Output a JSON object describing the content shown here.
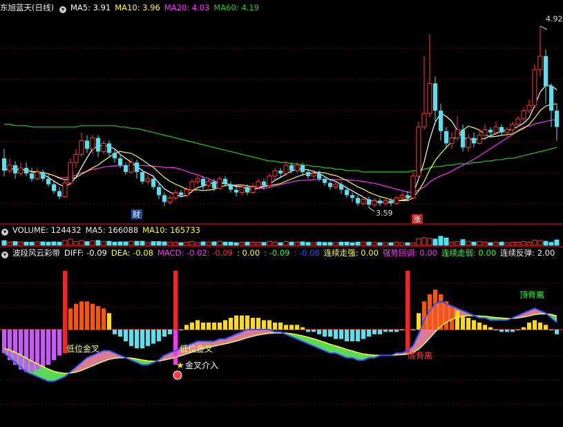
{
  "colors": {
    "background": "#000000",
    "rise": "#ff3b3b",
    "fall": "#54e1f0",
    "ma5": "#ffffff",
    "ma10": "#ffff33",
    "ma20": "#ff33ff",
    "ma60": "#22cc22",
    "grid": "#7a0000"
  },
  "price_panel": {
    "title": "东旭蓝天(日线)",
    "toggle_icon": "chevron-down-icon",
    "ma5_label": "MA5: 3.91",
    "ma10_label": "MA10: 3.96",
    "ma20_label": "MA20: 4.03",
    "ma60_label": "MA60: 4.19",
    "high_marker": "4.92",
    "low_marker": "3.59",
    "badge_finance": "财",
    "badge_rise": "涨"
  },
  "volume_panel": {
    "toggle_icon": "chevron-down-icon",
    "volume_label": "VOLUME: 124432",
    "ma5_label": "MA5: 166088",
    "ma10_label": "MA10: 165733"
  },
  "indicator_panel": {
    "toggle_icon": "chevron-down-icon",
    "title": "波段风云彩带",
    "diff_label": "DIFF: -0.09",
    "dea_label": "DEA: -0.08",
    "macd_label": "MACD: -0.02",
    "v1": ": -0.09",
    "v2": ": 0.00",
    "v3": ": -0.09",
    "v4": ": -0.08",
    "lianxu_zouqiang": "连续走强: 0.00",
    "qiangshi_huitiao": "强势回调: 0.00",
    "lianxu_zouruo": "连续走弱: 0.00",
    "lianxu_fantan": "连续反弹: 2.00",
    "ann_low_golden_1": "低位金叉",
    "ann_low_golden_2": "低位金叉",
    "ann_golden_entry": "金叉介入",
    "ann_bottom_div": "底背离",
    "ann_top_div": "顶背离"
  },
  "chart_data": {
    "type": "candlestick",
    "candles": [
      [
        3.95,
        3.86,
        4.02,
        3.82
      ],
      [
        3.86,
        3.9,
        3.95,
        3.84
      ],
      [
        3.9,
        3.84,
        3.93,
        3.8
      ],
      [
        3.84,
        3.88,
        3.92,
        3.82
      ],
      [
        3.88,
        3.84,
        3.92,
        3.82
      ],
      [
        3.84,
        3.8,
        3.88,
        3.78
      ],
      [
        3.8,
        3.85,
        3.88,
        3.79
      ],
      [
        3.85,
        3.8,
        3.87,
        3.78
      ],
      [
        3.8,
        3.76,
        3.83,
        3.74
      ],
      [
        3.76,
        3.71,
        3.78,
        3.69
      ],
      [
        3.71,
        3.67,
        3.74,
        3.65
      ],
      [
        3.67,
        3.77,
        3.79,
        3.66
      ],
      [
        3.77,
        3.92,
        3.95,
        3.75
      ],
      [
        3.92,
        3.98,
        4.02,
        3.88
      ],
      [
        3.98,
        4.08,
        4.14,
        3.96
      ],
      [
        4.08,
        4.02,
        4.12,
        3.99
      ],
      [
        4.02,
        4.1,
        4.12,
        3.98
      ],
      [
        4.1,
        4.0,
        4.12,
        3.96
      ],
      [
        4.0,
        4.06,
        4.08,
        3.98
      ],
      [
        4.06,
        3.99,
        4.08,
        3.96
      ],
      [
        3.99,
        3.95,
        4.02,
        3.92
      ],
      [
        3.95,
        3.9,
        3.98,
        3.88
      ],
      [
        3.9,
        3.85,
        3.92,
        3.83
      ],
      [
        3.85,
        3.92,
        3.95,
        3.84
      ],
      [
        3.92,
        3.85,
        3.94,
        3.8
      ],
      [
        3.85,
        3.78,
        3.87,
        3.76
      ],
      [
        3.78,
        3.8,
        3.83,
        3.76
      ],
      [
        3.8,
        3.74,
        3.83,
        3.72
      ],
      [
        3.74,
        3.68,
        3.77,
        3.65
      ],
      [
        3.68,
        3.63,
        3.7,
        3.6
      ],
      [
        3.63,
        3.66,
        3.68,
        3.61
      ],
      [
        3.66,
        3.7,
        3.72,
        3.64
      ],
      [
        3.7,
        3.68,
        3.72,
        3.66
      ],
      [
        3.68,
        3.72,
        3.74,
        3.66
      ],
      [
        3.72,
        3.78,
        3.8,
        3.7
      ],
      [
        3.78,
        3.8,
        3.82,
        3.76
      ],
      [
        3.8,
        3.75,
        3.82,
        3.72
      ],
      [
        3.75,
        3.78,
        3.8,
        3.73
      ],
      [
        3.78,
        3.73,
        3.8,
        3.71
      ],
      [
        3.73,
        3.8,
        3.82,
        3.72
      ],
      [
        3.8,
        3.76,
        3.82,
        3.74
      ],
      [
        3.76,
        3.72,
        3.78,
        3.7
      ],
      [
        3.72,
        3.7,
        3.74,
        3.67
      ],
      [
        3.7,
        3.74,
        3.76,
        3.68
      ],
      [
        3.74,
        3.7,
        3.76,
        3.68
      ],
      [
        3.7,
        3.74,
        3.77,
        3.69
      ],
      [
        3.74,
        3.78,
        3.8,
        3.72
      ],
      [
        3.78,
        3.75,
        3.8,
        3.72
      ],
      [
        3.75,
        3.82,
        3.84,
        3.74
      ],
      [
        3.82,
        3.86,
        3.88,
        3.79
      ],
      [
        3.86,
        3.84,
        3.88,
        3.81
      ],
      [
        3.84,
        3.9,
        3.93,
        3.82
      ],
      [
        3.9,
        3.86,
        3.92,
        3.84
      ],
      [
        3.86,
        3.9,
        3.92,
        3.84
      ],
      [
        3.9,
        3.85,
        3.92,
        3.82
      ],
      [
        3.85,
        3.82,
        3.87,
        3.8
      ],
      [
        3.82,
        3.84,
        3.87,
        3.8
      ],
      [
        3.84,
        3.8,
        3.86,
        3.78
      ],
      [
        3.8,
        3.77,
        3.82,
        3.75
      ],
      [
        3.77,
        3.74,
        3.79,
        3.72
      ],
      [
        3.74,
        3.76,
        3.78,
        3.72
      ],
      [
        3.76,
        3.72,
        3.78,
        3.69
      ],
      [
        3.72,
        3.68,
        3.74,
        3.66
      ],
      [
        3.68,
        3.66,
        3.7,
        3.63
      ],
      [
        3.66,
        3.62,
        3.68,
        3.6
      ],
      [
        3.62,
        3.65,
        3.67,
        3.6
      ],
      [
        3.65,
        3.61,
        3.67,
        3.59
      ],
      [
        3.61,
        3.64,
        3.66,
        3.59
      ],
      [
        3.64,
        3.62,
        3.66,
        3.6
      ],
      [
        3.62,
        3.64,
        3.66,
        3.6
      ],
      [
        3.64,
        3.62,
        3.66,
        3.6
      ],
      [
        3.62,
        3.66,
        3.68,
        3.61
      ],
      [
        3.66,
        3.68,
        3.7,
        3.64
      ],
      [
        3.68,
        3.66,
        3.71,
        3.64
      ],
      [
        3.66,
        3.82,
        3.85,
        3.65
      ],
      [
        3.82,
        4.18,
        4.22,
        3.8
      ],
      [
        4.18,
        4.28,
        4.7,
        4.16
      ],
      [
        4.28,
        4.5,
        4.86,
        4.25
      ],
      [
        4.5,
        4.3,
        4.55,
        4.2
      ],
      [
        4.3,
        4.15,
        4.35,
        4.08
      ],
      [
        4.15,
        4.06,
        4.18,
        4.02
      ],
      [
        4.06,
        4.1,
        4.14,
        4.02
      ],
      [
        4.1,
        4.16,
        4.26,
        4.08
      ],
      [
        4.16,
        4.03,
        4.2,
        4.0
      ],
      [
        4.03,
        4.1,
        4.13,
        4.0
      ],
      [
        4.1,
        4.06,
        4.14,
        4.03
      ],
      [
        4.06,
        4.12,
        4.16,
        4.05
      ],
      [
        4.12,
        4.16,
        4.2,
        4.1
      ],
      [
        4.16,
        4.14,
        4.18,
        4.1
      ],
      [
        4.14,
        4.18,
        4.22,
        4.12
      ],
      [
        4.18,
        4.14,
        4.2,
        4.12
      ],
      [
        4.14,
        4.16,
        4.18,
        4.1
      ],
      [
        4.16,
        4.2,
        4.22,
        4.12
      ],
      [
        4.2,
        4.24,
        4.26,
        4.18
      ],
      [
        4.24,
        4.3,
        4.32,
        4.22
      ],
      [
        4.3,
        4.34,
        4.38,
        4.28
      ],
      [
        4.34,
        4.6,
        4.64,
        4.32
      ],
      [
        4.6,
        4.7,
        4.92,
        4.55
      ],
      [
        4.7,
        4.48,
        4.75,
        4.35
      ],
      [
        4.48,
        4.3,
        4.5,
        4.18
      ],
      [
        4.3,
        4.18,
        4.35,
        4.08
      ]
    ],
    "ma60": [
      4.2,
      4.2,
      4.19,
      4.19,
      4.19,
      4.18,
      4.18,
      4.18,
      4.18,
      4.18,
      4.18,
      4.18,
      4.18,
      4.18,
      4.19,
      4.19,
      4.19,
      4.19,
      4.19,
      4.19,
      4.19,
      4.18,
      4.18,
      4.17,
      4.17,
      4.16,
      4.15,
      4.14,
      4.13,
      4.12,
      4.11,
      4.1,
      4.09,
      4.08,
      4.07,
      4.06,
      4.05,
      4.04,
      4.03,
      4.02,
      4.01,
      4.0,
      3.99,
      3.98,
      3.97,
      3.96,
      3.95,
      3.94,
      3.93,
      3.93,
      3.92,
      3.92,
      3.91,
      3.91,
      3.9,
      3.9,
      3.89,
      3.89,
      3.88,
      3.88,
      3.87,
      3.87,
      3.86,
      3.86,
      3.86,
      3.85,
      3.85,
      3.85,
      3.85,
      3.85,
      3.85,
      3.85,
      3.85,
      3.85,
      3.86,
      3.86,
      3.87,
      3.88,
      3.89,
      3.89,
      3.9,
      3.9,
      3.91,
      3.91,
      3.91,
      3.92,
      3.92,
      3.93,
      3.93,
      3.94,
      3.94,
      3.95,
      3.95,
      3.96,
      3.97,
      3.98,
      3.99,
      4.0,
      4.01,
      4.02,
      4.03
    ],
    "macd": [
      -0.1,
      -0.13,
      -0.15,
      -0.17,
      -0.18,
      -0.18,
      -0.17,
      -0.16,
      -0.15,
      -0.13,
      -0.11,
      0.05,
      0.09,
      0.11,
      0.12,
      0.12,
      0.11,
      0.1,
      0.09,
      0.07,
      -0.02,
      -0.03,
      -0.05,
      -0.07,
      -0.08,
      -0.08,
      -0.07,
      -0.06,
      -0.05,
      -0.03,
      -0.02,
      -0.01,
      0.0,
      0.02,
      0.03,
      0.04,
      0.03,
      0.03,
      0.03,
      0.03,
      0.04,
      0.05,
      0.06,
      0.06,
      0.06,
      0.05,
      0.05,
      0.04,
      0.04,
      0.03,
      0.03,
      0.02,
      0.02,
      0.02,
      0.01,
      -0.01,
      -0.01,
      -0.02,
      -0.03,
      -0.03,
      -0.04,
      -0.04,
      -0.05,
      -0.05,
      -0.05,
      -0.04,
      -0.03,
      -0.02,
      -0.02,
      -0.01,
      -0.01,
      -0.01,
      0.0,
      0.0,
      0.0,
      0.07,
      0.12,
      0.15,
      0.17,
      0.15,
      0.12,
      0.1,
      0.08,
      0.06,
      0.05,
      0.04,
      0.03,
      0.02,
      0.01,
      0.0,
      -0.01,
      -0.01,
      -0.01,
      0.0,
      0.01,
      0.03,
      0.04,
      0.03,
      0.02,
      0.0,
      -0.02
    ],
    "diff": [
      -0.1,
      -0.12,
      -0.14,
      -0.16,
      -0.18,
      -0.19,
      -0.2,
      -0.21,
      -0.22,
      -0.22,
      -0.21,
      -0.2,
      -0.18,
      -0.16,
      -0.14,
      -0.12,
      -0.11,
      -0.1,
      -0.09,
      -0.09,
      -0.1,
      -0.11,
      -0.12,
      -0.13,
      -0.14,
      -0.15,
      -0.15,
      -0.14,
      -0.13,
      -0.11,
      -0.1,
      -0.09,
      -0.08,
      -0.07,
      -0.06,
      -0.05,
      -0.05,
      -0.05,
      -0.05,
      -0.04,
      -0.04,
      -0.03,
      -0.02,
      -0.01,
      0.0,
      0.0,
      0.0,
      0.0,
      0.0,
      -0.01,
      -0.01,
      -0.02,
      -0.03,
      -0.04,
      -0.05,
      -0.06,
      -0.07,
      -0.08,
      -0.09,
      -0.1,
      -0.1,
      -0.11,
      -0.12,
      -0.12,
      -0.13,
      -0.13,
      -0.12,
      -0.12,
      -0.11,
      -0.11,
      -0.11,
      -0.1,
      -0.1,
      -0.09,
      -0.07,
      -0.02,
      0.04,
      0.08,
      0.11,
      0.12,
      0.11,
      0.1,
      0.09,
      0.08,
      0.07,
      0.06,
      0.05,
      0.05,
      0.04,
      0.04,
      0.04,
      0.04,
      0.05,
      0.06,
      0.07,
      0.08,
      0.09,
      0.08,
      0.07,
      0.05,
      0.03
    ],
    "ylim_price": [
      3.5,
      5.0
    ],
    "ylim_macd": [
      -0.25,
      0.25
    ]
  }
}
